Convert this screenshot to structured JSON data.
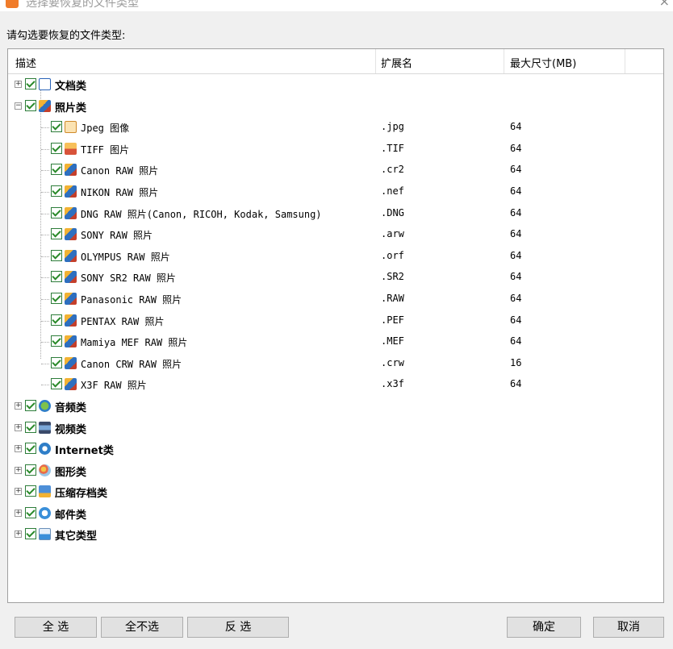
{
  "window": {
    "title": "选择要恢复的文件类型",
    "close_glyph": "×"
  },
  "prompt": "请勾选要恢复的文件类型:",
  "columns": {
    "desc": "描述",
    "ext": "扩展名",
    "size": "最大尺寸(MB)"
  },
  "rows": [
    {
      "type": "category",
      "label": "文档类",
      "expanded": false,
      "icon": "word-doc-icon"
    },
    {
      "type": "category",
      "label": "照片类",
      "expanded": true,
      "icon": "photo-icon"
    },
    {
      "type": "item",
      "label": "Jpeg 图像",
      "ext": ".jpg",
      "size": "64",
      "icon": "jpeg-icon"
    },
    {
      "type": "item",
      "label": "TIFF 图片",
      "ext": ".TIF",
      "size": "64",
      "icon": "tiff-icon"
    },
    {
      "type": "item",
      "label": "Canon RAW 照片",
      "ext": ".cr2",
      "size": "64",
      "icon": "raw-photo-icon"
    },
    {
      "type": "item",
      "label": "NIKON RAW 照片",
      "ext": ".nef",
      "size": "64",
      "icon": "raw-photo-icon"
    },
    {
      "type": "item",
      "label": "DNG RAW 照片(Canon, RICOH, Kodak, Samsung)",
      "ext": ".DNG",
      "size": "64",
      "icon": "raw-photo-icon"
    },
    {
      "type": "item",
      "label": "SONY RAW 照片",
      "ext": ".arw",
      "size": "64",
      "icon": "raw-photo-icon"
    },
    {
      "type": "item",
      "label": "OLYMPUS RAW 照片",
      "ext": ".orf",
      "size": "64",
      "icon": "raw-photo-icon"
    },
    {
      "type": "item",
      "label": "SONY SR2 RAW 照片",
      "ext": ".SR2",
      "size": "64",
      "icon": "raw-photo-icon"
    },
    {
      "type": "item",
      "label": "Panasonic RAW 照片",
      "ext": ".RAW",
      "size": "64",
      "icon": "raw-photo-icon"
    },
    {
      "type": "item",
      "label": "PENTAX RAW 照片",
      "ext": ".PEF",
      "size": "64",
      "icon": "raw-photo-icon"
    },
    {
      "type": "item",
      "label": "Mamiya MEF RAW 照片",
      "ext": ".MEF",
      "size": "64",
      "icon": "raw-photo-icon"
    },
    {
      "type": "item",
      "label": "Canon CRW RAW 照片",
      "ext": ".crw",
      "size": "16",
      "icon": "raw-photo-icon"
    },
    {
      "type": "item",
      "label": "X3F RAW 照片",
      "ext": ".x3f",
      "size": "64",
      "icon": "raw-photo-icon"
    },
    {
      "type": "category",
      "label": "音频类",
      "expanded": false,
      "icon": "audio-icon"
    },
    {
      "type": "category",
      "label": "视频类",
      "expanded": false,
      "icon": "video-icon"
    },
    {
      "type": "category",
      "label": "Internet类",
      "expanded": false,
      "icon": "internet-explorer-icon"
    },
    {
      "type": "category",
      "label": "图形类",
      "expanded": false,
      "icon": "graphics-icon"
    },
    {
      "type": "category",
      "label": "压缩存档类",
      "expanded": false,
      "icon": "archive-icon"
    },
    {
      "type": "category",
      "label": "邮件类",
      "expanded": false,
      "icon": "mail-icon"
    },
    {
      "type": "category",
      "label": "其它类型",
      "expanded": false,
      "icon": "other-icon"
    }
  ],
  "buttons": {
    "select_all": "全 选",
    "select_none": "全不选",
    "invert": "反 选",
    "ok": "确定",
    "cancel": "取消"
  },
  "colors": {
    "check_green": "#2a8a2a",
    "accent": "#f07c2a"
  }
}
